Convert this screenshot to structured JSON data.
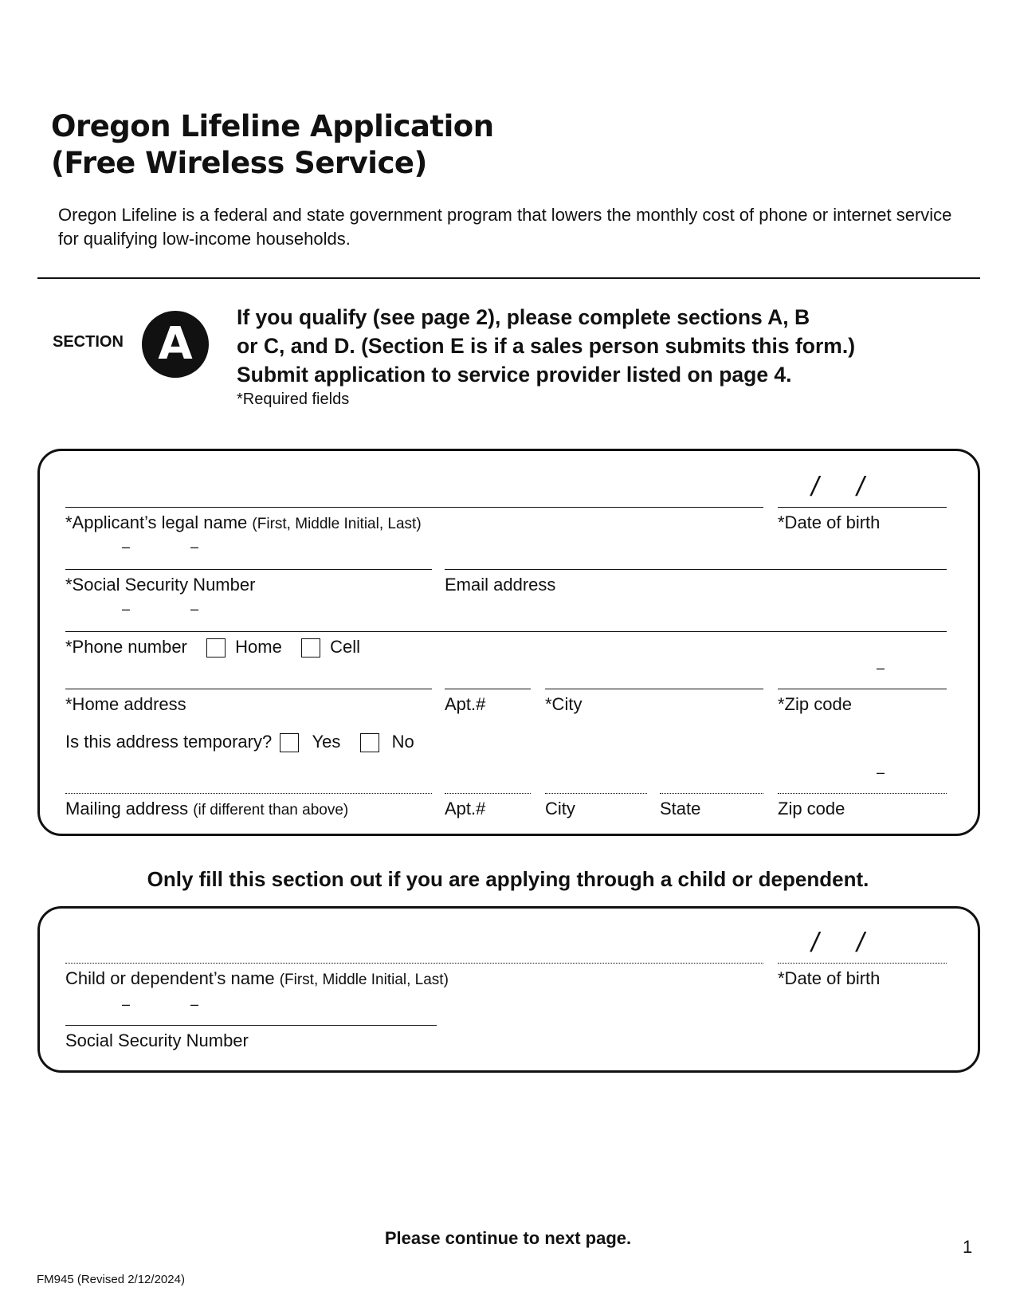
{
  "header": {
    "title_line1": "Oregon Lifeline Application",
    "title_line2": "(Free Wireless Service)",
    "intro": "Oregon Lifeline is a federal and state government program that lowers the monthly cost of phone or internet service for qualifying low-income households."
  },
  "section_a": {
    "label": "SECTION",
    "badge": "A",
    "instructions": [
      "If you qualify (see page 2), please complete sections A, B",
      "or C, and D. (Section E is if a sales person submits this form.)",
      "Submit application to service provider listed on page 4."
    ],
    "required_note": "*Required fields",
    "fields": {
      "legal_name": {
        "label": "*Applicant’s legal name",
        "hint": "(First, Middle Initial, Last)",
        "value": ""
      },
      "dob": {
        "label": "*Date of birth",
        "separator": "/",
        "value": ""
      },
      "ssn": {
        "label": "*Social Security Number",
        "separator": "–",
        "value": ""
      },
      "email": {
        "label": "Email address",
        "value": ""
      },
      "phone": {
        "label": "*Phone number",
        "separator": "–",
        "value": "",
        "options": [
          {
            "label": "Home",
            "checked": false
          },
          {
            "label": "Cell",
            "checked": false
          }
        ]
      },
      "home_address": {
        "label": "*Home address",
        "value": ""
      },
      "home_apt": {
        "label": "Apt.#",
        "value": ""
      },
      "home_city": {
        "label": "*City",
        "value": ""
      },
      "home_zip": {
        "label": "*Zip code",
        "separator": "–",
        "value": ""
      },
      "temporary": {
        "label": "Is this address temporary?",
        "options": [
          {
            "label": "Yes",
            "checked": false
          },
          {
            "label": "No",
            "checked": false
          }
        ]
      },
      "mailing_address": {
        "label": "Mailing address",
        "hint": "(if different than above)",
        "value": ""
      },
      "mailing_apt": {
        "label": "Apt.#",
        "value": ""
      },
      "mailing_city": {
        "label": "City",
        "value": ""
      },
      "mailing_state": {
        "label": "State",
        "value": ""
      },
      "mailing_zip": {
        "label": "Zip code",
        "separator": "–",
        "value": ""
      }
    }
  },
  "dependent": {
    "heading": "Only fill this section out if you are applying through a child or dependent.",
    "fields": {
      "name": {
        "label": "Child or dependent’s name",
        "hint": "(First, Middle Initial, Last)",
        "value": ""
      },
      "dob": {
        "label": "*Date of birth",
        "separator": "/",
        "value": ""
      },
      "ssn": {
        "label": "Social Security Number",
        "separator": "–",
        "value": ""
      }
    }
  },
  "footer": {
    "continue": "Please continue to next page.",
    "page_number": "1",
    "form_id": "FM945 (Revised 2/12/2024)"
  }
}
